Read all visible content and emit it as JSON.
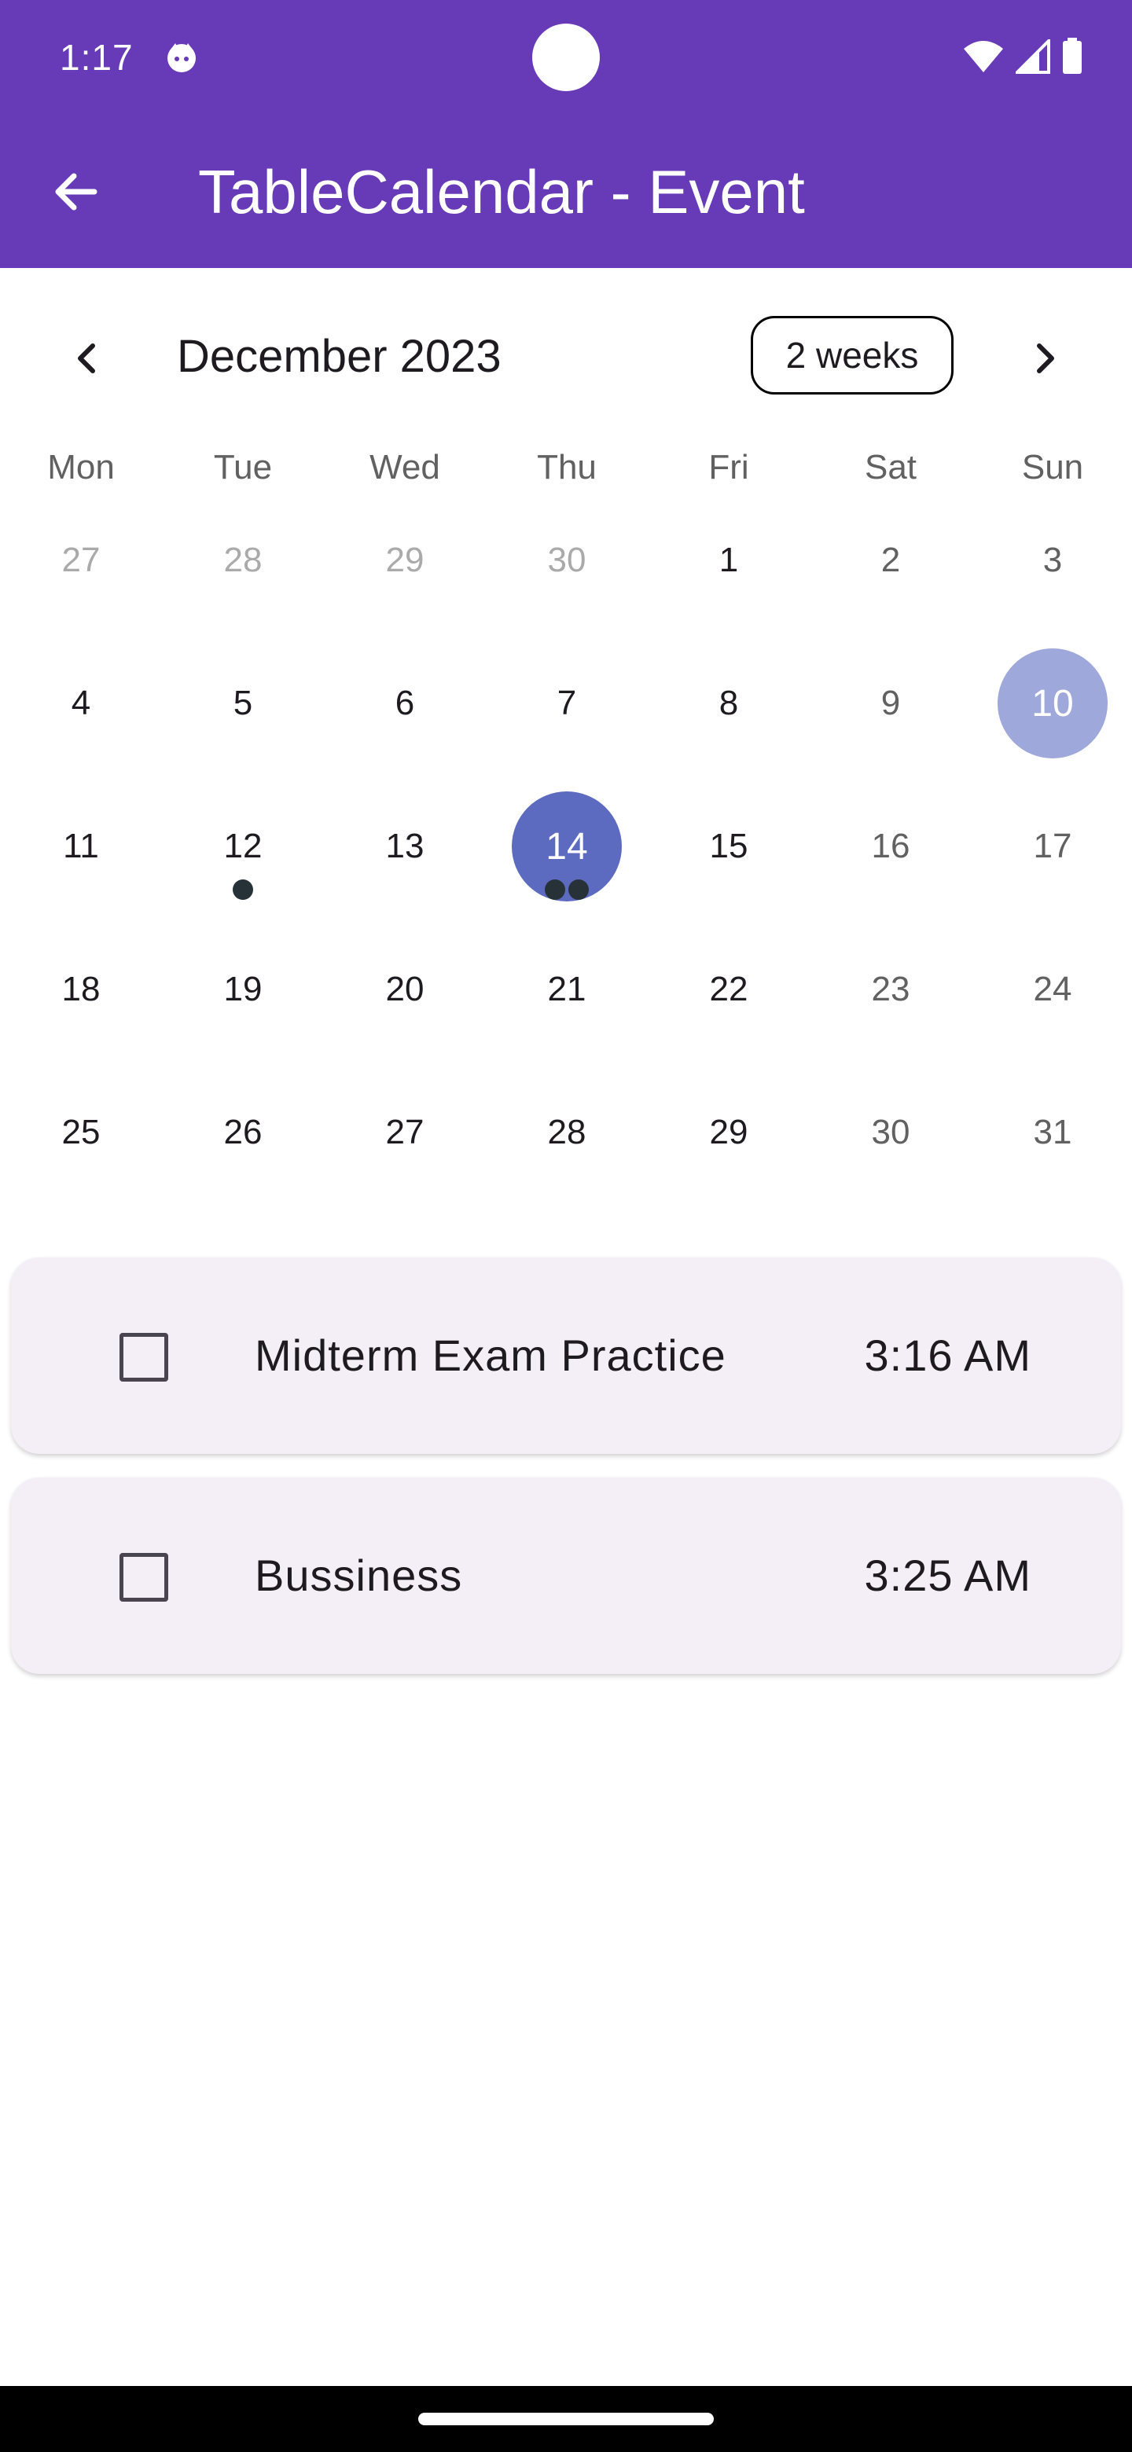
{
  "status_bar": {
    "time": "1:17"
  },
  "app_bar": {
    "title": "TableCalendar - Event",
    "color": "#673ab7"
  },
  "calendar": {
    "month_title": "December 2023",
    "format_button_label": "2 weeks",
    "weekdays": [
      "Mon",
      "Tue",
      "Wed",
      "Thu",
      "Fri",
      "Sat",
      "Sun"
    ],
    "weeks": [
      [
        {
          "label": "27",
          "kind": "outside"
        },
        {
          "label": "28",
          "kind": "outside"
        },
        {
          "label": "29",
          "kind": "outside"
        },
        {
          "label": "30",
          "kind": "outside"
        },
        {
          "label": "1",
          "kind": "normal"
        },
        {
          "label": "2",
          "kind": "weekend"
        },
        {
          "label": "3",
          "kind": "weekend"
        }
      ],
      [
        {
          "label": "4",
          "kind": "normal"
        },
        {
          "label": "5",
          "kind": "normal"
        },
        {
          "label": "6",
          "kind": "normal"
        },
        {
          "label": "7",
          "kind": "normal"
        },
        {
          "label": "8",
          "kind": "normal"
        },
        {
          "label": "9",
          "kind": "weekend"
        },
        {
          "label": "10",
          "kind": "today"
        }
      ],
      [
        {
          "label": "11",
          "kind": "normal"
        },
        {
          "label": "12",
          "kind": "normal",
          "markers": 1
        },
        {
          "label": "13",
          "kind": "normal"
        },
        {
          "label": "14",
          "kind": "selected",
          "markers": 2
        },
        {
          "label": "15",
          "kind": "normal"
        },
        {
          "label": "16",
          "kind": "weekend"
        },
        {
          "label": "17",
          "kind": "weekend"
        }
      ],
      [
        {
          "label": "18",
          "kind": "normal"
        },
        {
          "label": "19",
          "kind": "normal"
        },
        {
          "label": "20",
          "kind": "normal"
        },
        {
          "label": "21",
          "kind": "normal"
        },
        {
          "label": "22",
          "kind": "normal"
        },
        {
          "label": "23",
          "kind": "weekend"
        },
        {
          "label": "24",
          "kind": "weekend"
        }
      ],
      [
        {
          "label": "25",
          "kind": "normal"
        },
        {
          "label": "26",
          "kind": "normal"
        },
        {
          "label": "27",
          "kind": "normal"
        },
        {
          "label": "28",
          "kind": "normal"
        },
        {
          "label": "29",
          "kind": "normal"
        },
        {
          "label": "30",
          "kind": "weekend"
        },
        {
          "label": "31",
          "kind": "weekend"
        }
      ]
    ],
    "colors": {
      "today": "#9fa8da",
      "selected": "#5c6bc0",
      "marker": "#263238"
    }
  },
  "events": [
    {
      "title": "Midterm Exam Practice",
      "time": "3:16 AM",
      "checked": false
    },
    {
      "title": "Bussiness",
      "time": "3:25 AM",
      "checked": false
    }
  ]
}
